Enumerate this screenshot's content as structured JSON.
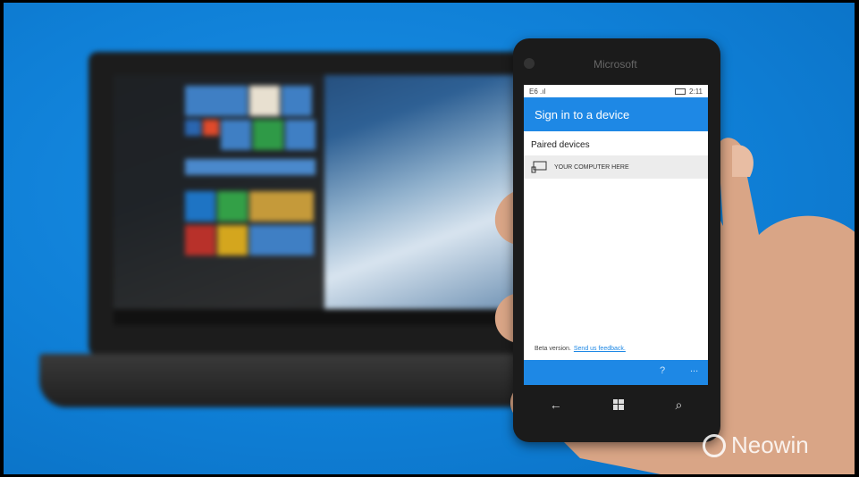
{
  "phone": {
    "brand": "Microsoft",
    "status_left": "E6 .ıl",
    "status_time": "2:11",
    "header_title": "Sign in to a device",
    "section_title": "Paired devices",
    "device_label": "YOUR COMPUTER HERE",
    "beta_text": "Beta version.",
    "feedback_link": "Send us feedback.",
    "appbar_help": "?",
    "appbar_more": "...",
    "nav_back": "←",
    "nav_search": "⌕"
  },
  "watermark": {
    "text": "Neowin"
  },
  "colors": {
    "background": "#0f7fd6",
    "accent": "#1e88e5"
  }
}
